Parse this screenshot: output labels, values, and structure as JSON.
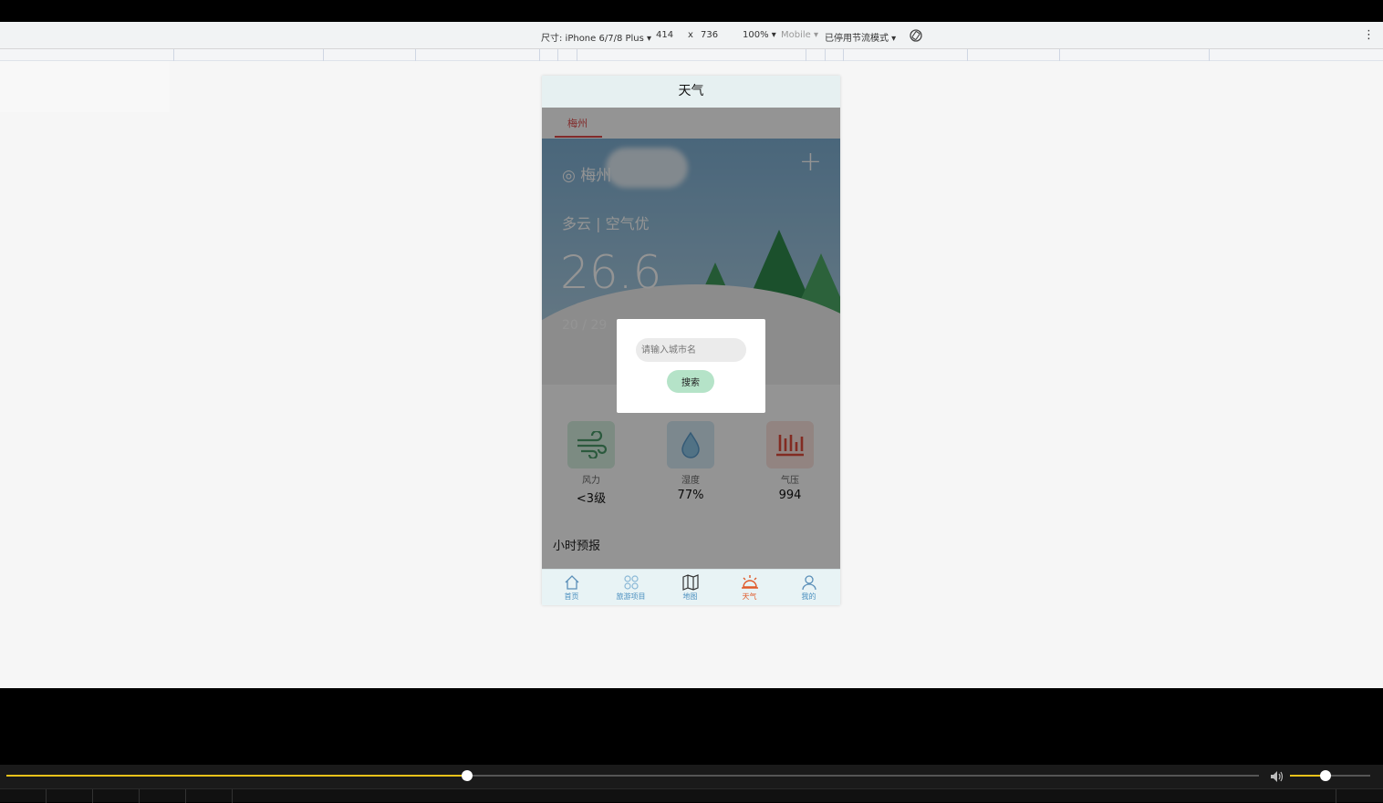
{
  "devtools": {
    "device": "尺寸: iPhone 6/7/8 Plus ▾",
    "width": "414",
    "times": "x",
    "height": "736",
    "zoom": "100% ▾",
    "mode": "Mobile ▾",
    "throttle": "已停用节流模式 ▾",
    "more": "⋮"
  },
  "app": {
    "title": "天气",
    "city_tab": "梅州",
    "location": "◎ 梅州",
    "add": "+",
    "condition": "多云 | 空气优",
    "temperature": "26.6",
    "range": "20 / 29",
    "stats": [
      {
        "label": "风力",
        "value": "<3级",
        "icon": "wind-icon",
        "color": "#d6efe0"
      },
      {
        "label": "湿度",
        "value": "77%",
        "icon": "humidity-icon",
        "color": "#d6eaf5"
      },
      {
        "label": "气压",
        "value": "994",
        "icon": "pressure-icon",
        "color": "#fbe3df"
      }
    ],
    "hourly_title": "小时预报",
    "dialog": {
      "placeholder": "请输入城市名",
      "button": "搜索"
    },
    "tabs": [
      {
        "label": "首页",
        "icon": "home-icon"
      },
      {
        "label": "旅游项目",
        "icon": "grid-icon"
      },
      {
        "label": "地图",
        "icon": "map-icon"
      },
      {
        "label": "天气",
        "icon": "weather-icon",
        "active": true
      },
      {
        "label": "我的",
        "icon": "user-icon"
      }
    ]
  },
  "player": {
    "progress": 0.368,
    "volume": 0.44
  },
  "colors": {
    "accent_progress": "#e8c21a",
    "tab_active": "#e05a2a",
    "tab_inactive": "#4a8fbf",
    "search_button": "#b5e3c8"
  }
}
